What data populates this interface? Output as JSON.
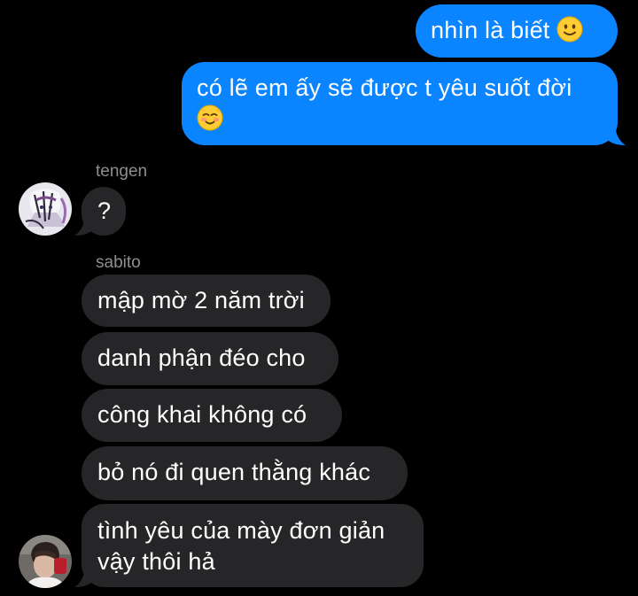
{
  "thread": {
    "sent": [
      {
        "text": "nhìn là biết",
        "emoji": "slightly-smiling-face-emoji"
      },
      {
        "line1": "có lẽ em ấy sẽ được t yêu suốt đời",
        "emoji": "smiling-blushing-face-emoji"
      }
    ],
    "groups": [
      {
        "sender": "tengen",
        "avatar_icon": "anime-character-avatar",
        "messages": [
          "?"
        ]
      },
      {
        "sender": "sabito",
        "avatar_icon": "person-photo-avatar",
        "messages": [
          "mập mờ 2 năm trời",
          "danh phận đéo cho",
          "công khai không có",
          "bỏ nó đi quen thằng khác"
        ],
        "last_message_lines": [
          "tình yêu của mày đơn giản",
          "vậy thôi hả"
        ]
      }
    ]
  },
  "colors": {
    "background": "#000000",
    "sent_bubble": "#0a84ff",
    "received_bubble": "#262628",
    "sender_name": "#8e8e93"
  }
}
